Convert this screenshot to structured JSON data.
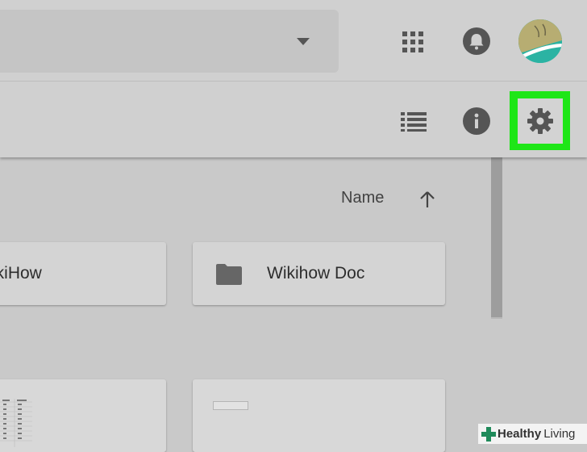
{
  "header": {
    "apps_icon": "apps-grid-icon",
    "notifications_icon": "bell-icon",
    "avatar": "user-avatar"
  },
  "toolbar": {
    "list_view_icon": "list-view-icon",
    "info_icon": "info-icon",
    "settings_icon": "gear-icon",
    "highlight_color": "#1ee617"
  },
  "sort": {
    "label": "Name",
    "direction_icon": "arrow-up-icon"
  },
  "folders": [
    {
      "label": "ikiHow"
    },
    {
      "label": "Wikihow Doc"
    }
  ],
  "watermark": {
    "healthy": "Healthy",
    "living": "Living"
  }
}
